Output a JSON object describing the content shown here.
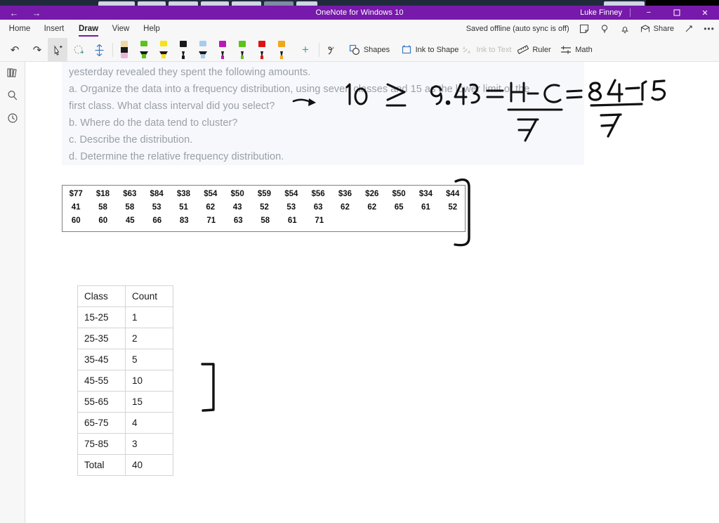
{
  "window": {
    "app_title": "OneNote for Windows 10",
    "user": "Luke Finney",
    "back_icon": "←",
    "forward_icon": "→",
    "minimize_icon": "−",
    "maximize_icon": "❐",
    "close_icon": "✕"
  },
  "ribbon": {
    "tabs": [
      {
        "label": "Home",
        "active": false
      },
      {
        "label": "Insert",
        "active": false
      },
      {
        "label": "Draw",
        "active": true
      },
      {
        "label": "View",
        "active": false
      },
      {
        "label": "Help",
        "active": false
      }
    ],
    "sync_status": "Saved offline (auto sync is off)",
    "sticky_note_icon": "⏷",
    "lightbulb_icon": "Ὂ1",
    "bell_icon": "ὑ4",
    "share_label": "Share",
    "expand_icon": "↗",
    "more_icon": "•••"
  },
  "drawbar": {
    "undo_icon": "↶",
    "redo_icon": "↷",
    "select_tool_icon": "lasso-select",
    "lasso_icon": "lasso-add",
    "space_icon": "↕",
    "pens": [
      {
        "name": "eraser-pen",
        "barrel": "#f0d7a8",
        "nib": "#e8b6d8",
        "type": "eraser"
      },
      {
        "name": "green-highlighter",
        "color": "#5fc11c",
        "type": "highlighter"
      },
      {
        "name": "yellow-highlighter",
        "color": "#f5e31a",
        "type": "highlighter"
      },
      {
        "name": "black-pen",
        "color": "#1a1a1a",
        "type": "pen"
      },
      {
        "name": "blue-highlighter",
        "color": "#a8cbee",
        "type": "highlighter"
      },
      {
        "name": "purple-pen",
        "color": "#b81ab8",
        "type": "pen"
      },
      {
        "name": "green-pen",
        "color": "#5fc11c",
        "type": "pen"
      },
      {
        "name": "red-pen",
        "color": "#e01313",
        "type": "pen"
      },
      {
        "name": "orange-pen",
        "color": "#f0a81a",
        "type": "pen"
      }
    ],
    "add_pen_icon": "+",
    "ink_color_icon": "ƒ",
    "shapes_label": "Shapes",
    "ink_to_shape_label": "Ink to Shape",
    "ink_to_text_label": "Ink to Text",
    "ruler_label": "Ruler",
    "math_label": "Math"
  },
  "rail": {
    "notebooks_icon": "Ὅ6",
    "search_icon": "⌕",
    "recent_icon": "ὕ8"
  },
  "page": {
    "question_lines": [
      "yesterday revealed they spent the following amounts.",
      "a. Organize the data into a frequency distribution, using seven classes and 15 as the lower limit of the",
      "first class. What class interval did you select?",
      "b. Where do the data tend to cluster?",
      "c. Describe the distribution.",
      "d. Determine the relative frequency distribution."
    ],
    "handwriting": {
      "inequality": "10  ≥   9.43 =",
      "fraction1_num": "H - C",
      "fraction1_den": "7",
      "equals": "=",
      "fraction2_num": "84 - 15",
      "fraction2_den": "7"
    },
    "data_box": {
      "rows": [
        [
          "$77",
          "$18",
          "$63",
          "$84",
          "$38",
          "$54",
          "$50",
          "$59",
          "$54",
          "$56",
          "$36",
          "$26",
          "$50",
          "$34",
          "$44"
        ],
        [
          "41",
          "58",
          "58",
          "53",
          "51",
          "62",
          "43",
          "52",
          "53",
          "63",
          "62",
          "62",
          "65",
          "61",
          "52"
        ],
        [
          "60",
          "60",
          "45",
          "66",
          "83",
          "71",
          "63",
          "58",
          "61",
          "71",
          "",
          "",
          "",
          "",
          ""
        ]
      ]
    },
    "freq_table": {
      "headers": [
        "Class",
        "Count"
      ],
      "rows": [
        [
          "15-25",
          "1"
        ],
        [
          "25-35",
          "2"
        ],
        [
          "35-45",
          "5"
        ],
        [
          "45-55",
          "10"
        ],
        [
          "55-65",
          "15"
        ],
        [
          "65-75",
          "4"
        ],
        [
          "75-85",
          "3"
        ],
        [
          "Total",
          "40"
        ]
      ]
    }
  }
}
